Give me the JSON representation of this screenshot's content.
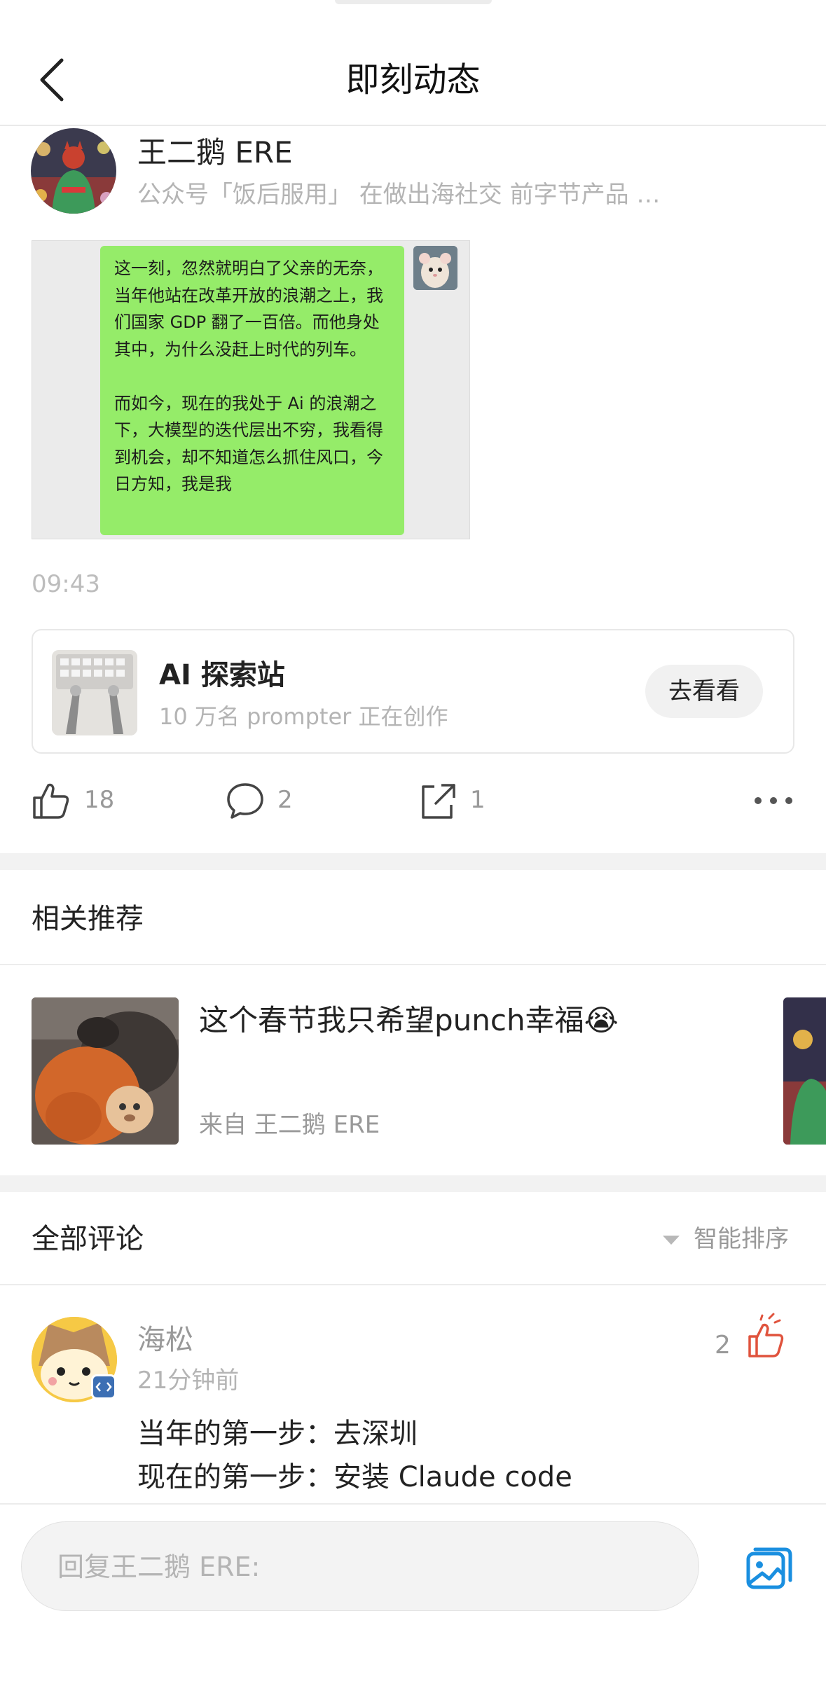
{
  "nav": {
    "title": "即刻动态",
    "back_icon": "chevron-left-icon"
  },
  "author": {
    "name": "王二鹅 ERE",
    "bio": "公众号「饭后服用」 在做出海社交 前字节产品 …"
  },
  "post": {
    "image_text": "这一刻，忽然就明白了父亲的无奈，当年他站在改革开放的浪潮之上，我们国家 GDP 翻了一百倍。而他身处其中，为什么没赶上时代的列车。\n\n而如今，现在的我处于 Ai 的浪潮之下，大模型的迭代层出不穷，我看得到机会，却不知道怎么抓住风口，今日方知，我是我",
    "time": "09:43"
  },
  "topic_card": {
    "title": "AI 探索站",
    "subtitle": "10 万名 prompter 正在创作",
    "button": "去看看"
  },
  "actions": {
    "like_count": "18",
    "comment_count": "2",
    "share_count": "1"
  },
  "recommend": {
    "section_title": "相关推荐",
    "item_title": "这个春节我只希望punch幸福😭",
    "item_from": "来自  王二鹅 ERE"
  },
  "comments": {
    "section_title": "全部评论",
    "sort_label": "智能排序",
    "items": [
      {
        "name": "海松",
        "time": "21分钟前",
        "like_count": "2",
        "line1": "当年的第一步：去深圳",
        "line2": "现在的第一步：安装  Claude code"
      }
    ]
  },
  "reply": {
    "placeholder": "回复王二鹅 ERE:"
  },
  "colors": {
    "chat_bubble": "#95ec69",
    "like_active": "#e0533d",
    "image_button": "#1a8fe0"
  }
}
